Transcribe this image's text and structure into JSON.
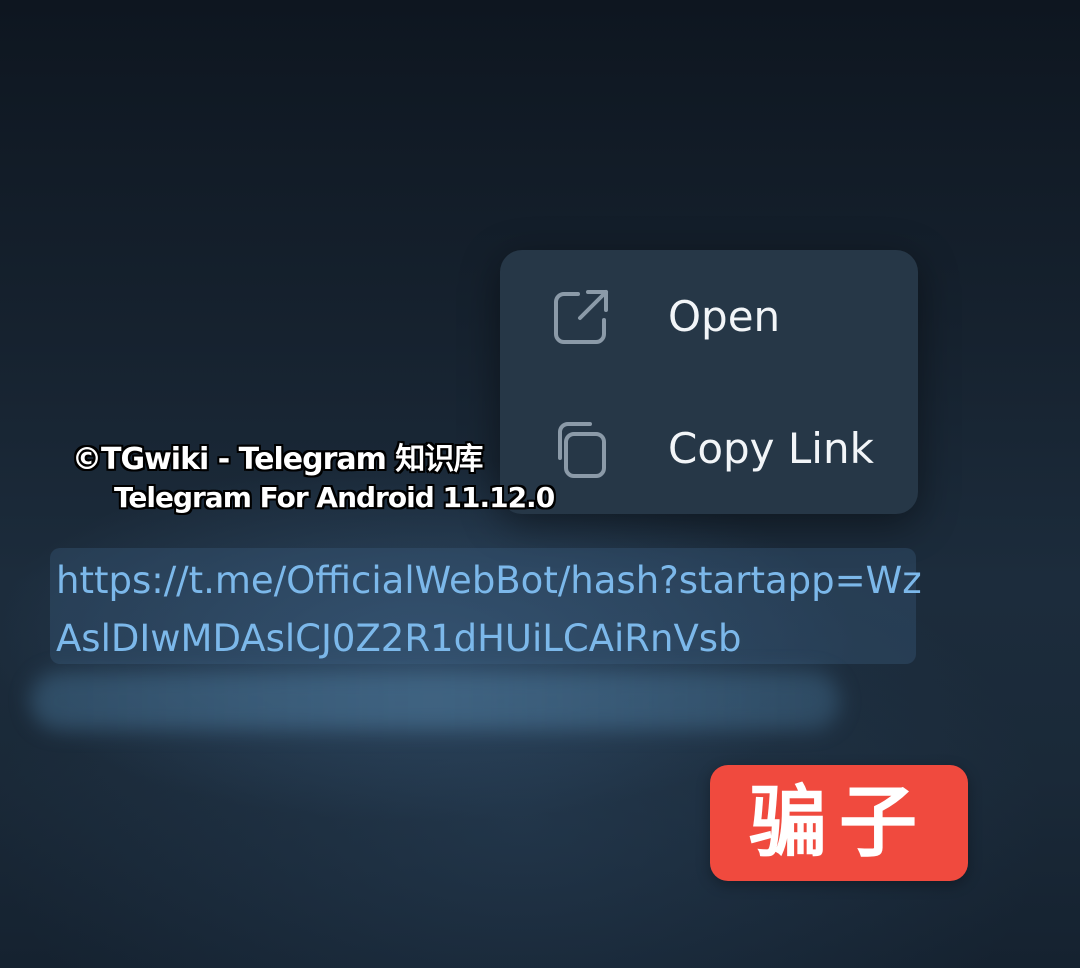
{
  "context_menu": {
    "items": [
      {
        "label": "Open",
        "icon": "external-link-icon"
      },
      {
        "label": "Copy Link",
        "icon": "copy-icon"
      }
    ]
  },
  "watermark": {
    "line1": "©TGwiki - Telegram 知识库",
    "line2": "Telegram For Android 11.12.0"
  },
  "message": {
    "link": "https://t.me/OfficialWebBot/hash?startapp=WzAslDIwMDAslCJ0Z2R1dHUiLCAiRnVsb",
    "link_color": "#7cb8ea"
  },
  "stamp": {
    "label": "骗子",
    "color": "#f04a3e"
  }
}
